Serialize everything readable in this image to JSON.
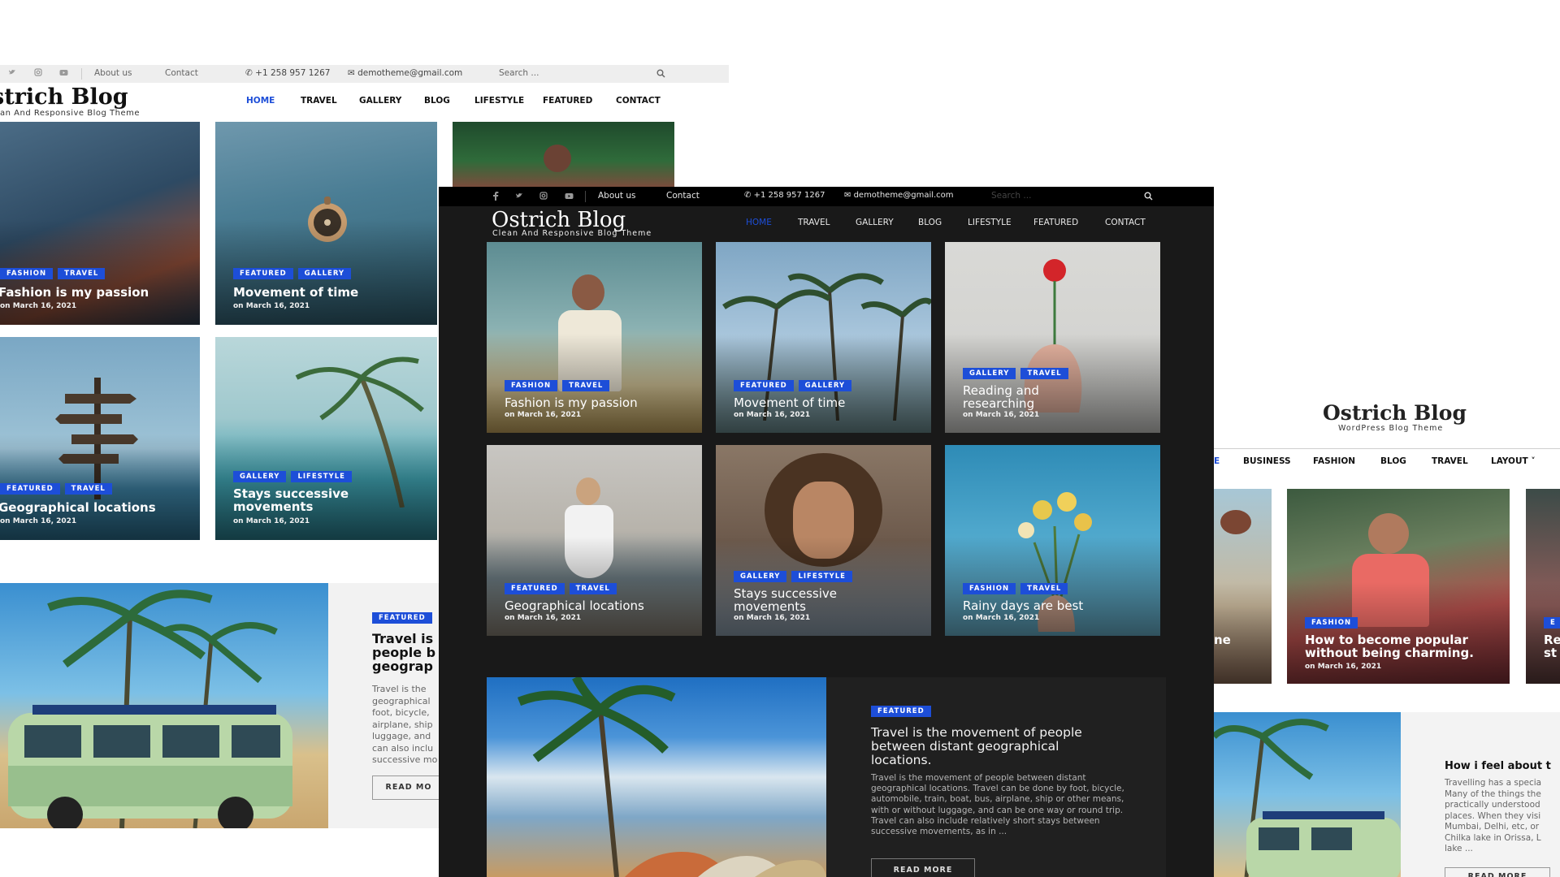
{
  "site": {
    "brand": "Ostrich Blog",
    "tagline_clean": "Clean And Responsive Blog Theme",
    "tagline_clean_cropped": "an And Responsive Blog Theme",
    "tagline_wp": "WordPress Blog Theme",
    "brand_cropped": "strich Blog"
  },
  "topbar": {
    "about": "About us",
    "contact": "Contact",
    "phone": "+1 258 957 1267",
    "email": "demotheme@gmail.com",
    "search_placeholder": "Search ...",
    "search_placeholder_dark": "Search ..."
  },
  "nav": [
    "HOME",
    "TRAVEL",
    "GALLERY",
    "BLOG",
    "LIFESTYLE",
    "FEATURED",
    "CONTACT"
  ],
  "nav_right": [
    "E",
    "BUSINESS",
    "FASHION",
    "BLOG",
    "TRAVEL",
    "LAYOUT"
  ],
  "posts_dark": [
    {
      "tags": [
        "FASHION",
        "TRAVEL"
      ],
      "title": "Fashion is my passion",
      "date": "on March 16, 2021"
    },
    {
      "tags": [
        "FEATURED",
        "GALLERY"
      ],
      "title": "Movement of time",
      "date": "on March 16, 2021"
    },
    {
      "tags": [
        "GALLERY",
        "TRAVEL"
      ],
      "title": "Reading and researching",
      "date": "on March 16, 2021"
    },
    {
      "tags": [
        "FEATURED",
        "TRAVEL"
      ],
      "title": "Geographical locations",
      "date": "on March 16, 2021"
    },
    {
      "tags": [
        "GALLERY",
        "LIFESTYLE"
      ],
      "title": "Stays successive movements",
      "date": "on March 16, 2021"
    },
    {
      "tags": [
        "FASHION",
        "TRAVEL"
      ],
      "title": "Rainy days are best",
      "date": "on March 16, 2021"
    }
  ],
  "posts_left": [
    {
      "tags": [
        "FASHION",
        "TRAVEL"
      ],
      "title": "Fashion is my passion",
      "date": "on March 16, 2021"
    },
    {
      "tags": [
        "FEATURED",
        "GALLERY"
      ],
      "title": "Movement of time",
      "date": "on March 16, 2021"
    },
    {
      "tags": [
        "FEATURED",
        "TRAVEL"
      ],
      "title": "Geographical locations",
      "date": "on March 16, 2021"
    },
    {
      "tags": [
        "GALLERY",
        "LIFESTYLE"
      ],
      "title": "Stays successive movements",
      "date": "on March 16, 2021"
    }
  ],
  "featured": {
    "tag": "FEATURED",
    "title": "Travel is the movement of people between distant geographical locations.",
    "excerpt": "Travel is the movement of people between distant geographical locations. Travel can be done by foot, bicycle, automobile, train, boat, bus, airplane, ship or other means, with or without luggage, and can be one way or round trip. Travel can also include relatively short stays between successive movements, as in ...",
    "read_more": "READ MORE"
  },
  "featured_left": {
    "tag": "FEATURED",
    "title_lines": [
      "Travel is",
      "people b",
      "geograp"
    ],
    "excerpt_lines": [
      "Travel is the",
      "geographical",
      "foot, bicycle,",
      "airplane, ship",
      "luggage, and",
      "can also inclu",
      "successive mo"
    ],
    "read_more": "READ MO"
  },
  "right": {
    "post": {
      "tag": "FASHION",
      "title": "How to become popular without being charming.",
      "date": "on March 16, 2021"
    },
    "partial_title": "ne",
    "partial_tag": "E",
    "partial_title2": [
      "Re",
      "st"
    ],
    "feel": {
      "title": "How i feel about t",
      "lines": [
        "Travelling has a specia",
        "Many of the things the",
        "practically understood",
        "places. When they visi",
        "Mumbai, Delhi, etc, or",
        "Chilka lake in Orissa, L",
        "lake ..."
      ],
      "read_more": "READ MORE"
    }
  },
  "colors": {
    "accent": "#1d4ed8",
    "dark_bg": "#191919",
    "topbar_dark": "#000000",
    "topbar_light": "#eeeeee",
    "nav_active": "#1d4ed8"
  }
}
